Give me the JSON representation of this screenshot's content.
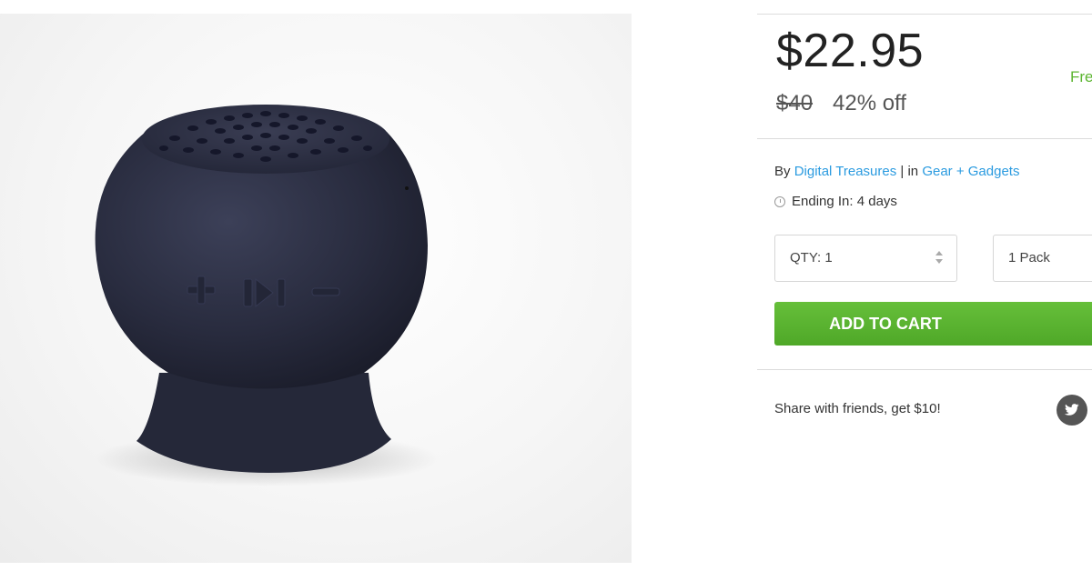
{
  "product": {
    "image_alt": "speaker-product-photo"
  },
  "pricing": {
    "price": "$22.95",
    "original_price": "$40",
    "discount": "42% off",
    "free_label": "Fre"
  },
  "meta": {
    "by_prefix": "By ",
    "seller": "Digital Treasures",
    "separator": " | in ",
    "category": "Gear + Gadgets",
    "ending": "Ending In: 4 days"
  },
  "purchase": {
    "qty_label": "QTY: 1",
    "variant_label": "1 Pack",
    "add_to_cart": "ADD TO CART"
  },
  "share": {
    "text": "Share with friends, get $10!"
  },
  "colors": {
    "accent_green": "#5cb531",
    "link_blue": "#2b9be0"
  }
}
